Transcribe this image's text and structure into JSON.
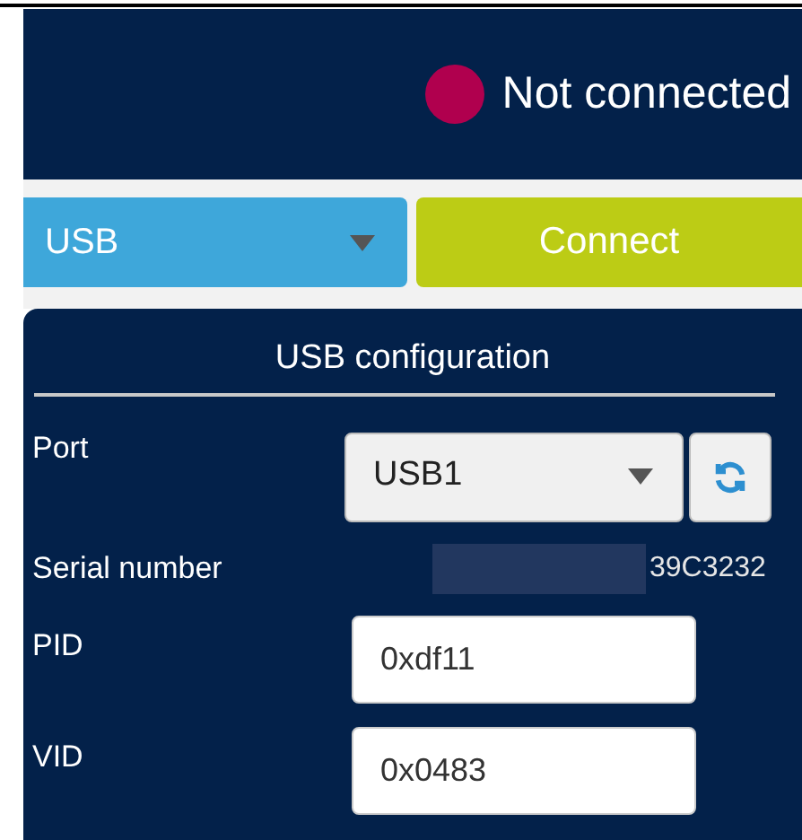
{
  "status": {
    "text": "Not connected",
    "connected": false
  },
  "interface": {
    "value": "USB"
  },
  "connect_button": {
    "label": "Connect"
  },
  "usb_configuration": {
    "title": "USB configuration",
    "port": {
      "label": "Port",
      "value": "USB1"
    },
    "serial_number": {
      "label": "Serial number",
      "value": "39C3232",
      "redacted": true
    },
    "pid": {
      "label": "PID",
      "value": "0xdf11"
    },
    "vid": {
      "label": "VID",
      "value": "0x0483"
    }
  }
}
